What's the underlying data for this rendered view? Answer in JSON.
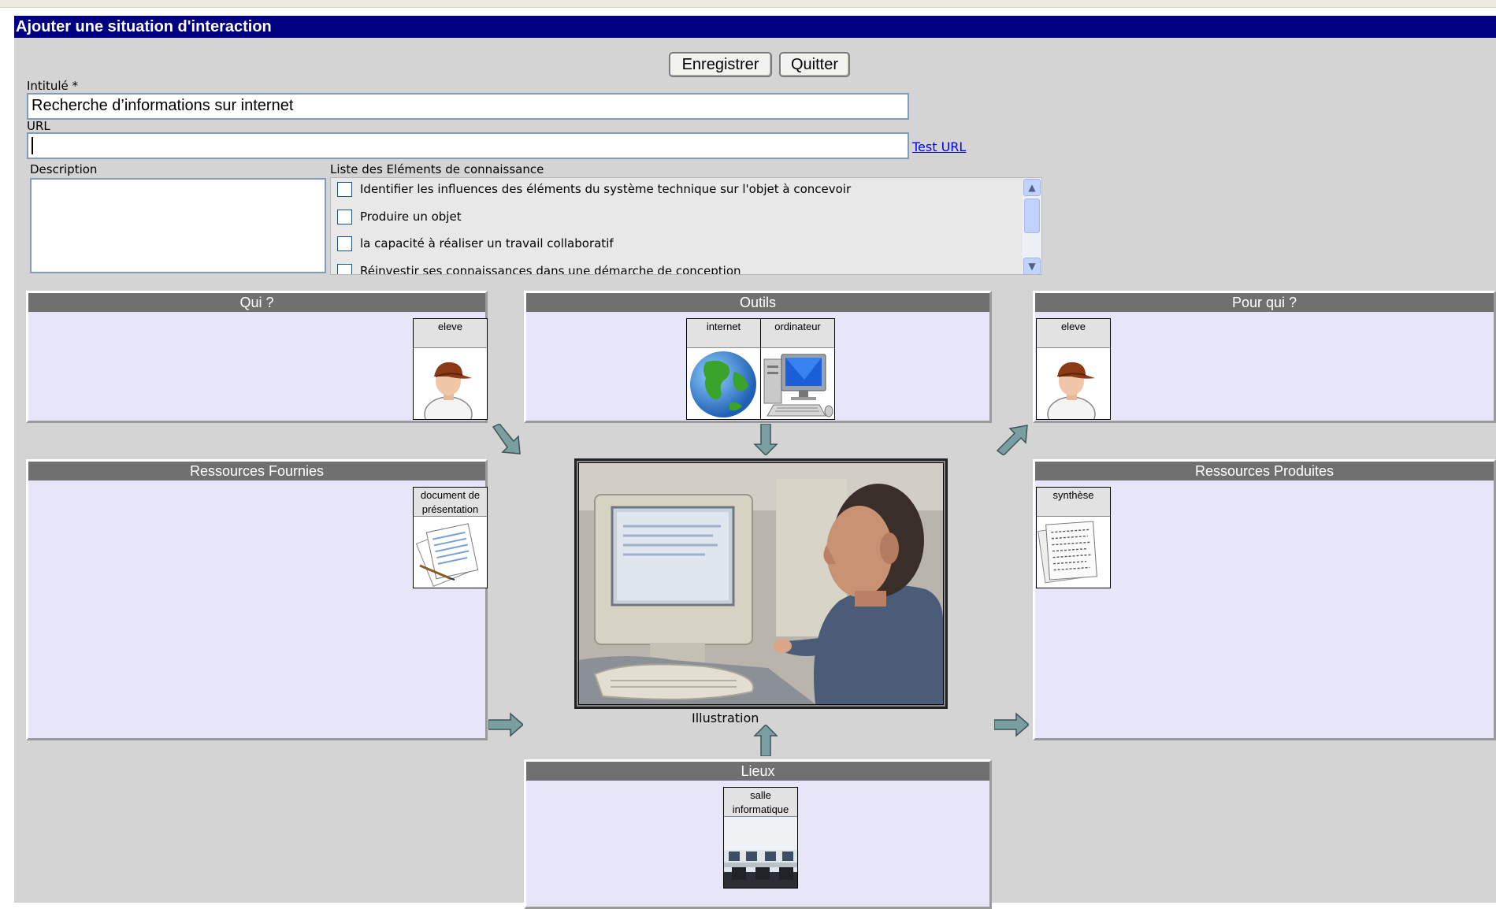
{
  "window": {
    "title": "Ajouter une situation d'interaction"
  },
  "toolbar": {
    "save_label": "Enregistrer",
    "quit_label": "Quitter"
  },
  "form": {
    "title_label": "Intitulé *",
    "title_value": "Recherche d’informations sur internet",
    "url_label": "URL",
    "url_value": "",
    "test_url_label": "Test URL",
    "description_label": "Description",
    "description_value": "",
    "knowledge_label": "Liste des Eléments de connaissance",
    "knowledge_items": [
      {
        "label": "Identifier les influences des éléments du système technique sur l'objet à concevoir",
        "checked": false
      },
      {
        "label": "Produire un objet",
        "checked": false
      },
      {
        "label": "la capacité à réaliser un travail collaboratif",
        "checked": false
      },
      {
        "label": "Réinvestir ses connaissances dans une démarche de conception",
        "checked": false
      }
    ]
  },
  "panels": {
    "qui": {
      "title": "Qui ?",
      "cards": [
        {
          "label": "eleve",
          "icon": "student-icon"
        }
      ]
    },
    "outils": {
      "title": "Outils",
      "cards": [
        {
          "label": "internet",
          "icon": "globe-icon"
        },
        {
          "label": "ordinateur",
          "icon": "computer-icon"
        }
      ]
    },
    "pour_qui": {
      "title": "Pour qui ?",
      "cards": [
        {
          "label": "eleve",
          "icon": "student-icon"
        }
      ]
    },
    "ressources_fournies": {
      "title": "Ressources Fournies",
      "cards": [
        {
          "label": "document de présentation",
          "icon": "document-icon"
        }
      ]
    },
    "ressources_produites": {
      "title": "Ressources Produites",
      "cards": [
        {
          "label": "synthèse",
          "icon": "notes-icon"
        }
      ]
    },
    "lieux": {
      "title": "Lieux",
      "cards": [
        {
          "label": "salle informatique",
          "icon": "classroom-photo"
        }
      ]
    }
  },
  "illustration": {
    "caption": "Illustration"
  },
  "colors": {
    "title_bar": "#000080",
    "panel_header": "#707070",
    "panel_body": "#e6e6f8",
    "background": "#d4d4d4",
    "link": "#0000ee"
  }
}
